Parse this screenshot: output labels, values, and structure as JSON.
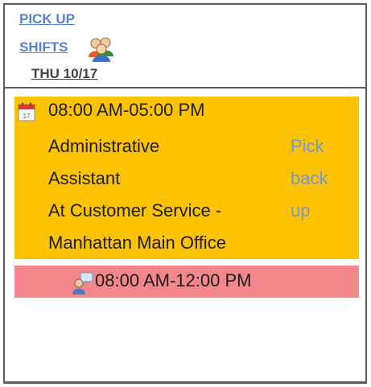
{
  "header": {
    "pickup_line1": "PICK UP",
    "pickup_line2": "SHIFTS",
    "people_icon": "users-icon",
    "date": "THU 10/17"
  },
  "shift": {
    "icon": "calendar-icon",
    "time": "08:00 AM-05:00 PM",
    "role_lines": [
      "Administrative",
      "Assistant",
      "At Customer Service -",
      "Manhattan Main Office"
    ],
    "action_lines": [
      "Pick",
      "back",
      "up"
    ]
  },
  "pickup_slot": {
    "icon": "chat-user-icon",
    "time": "08:00 AM-12:00 PM"
  },
  "colors": {
    "shift_bg": "#fdc300",
    "pickup_bg": "#f3878c",
    "link": "#5a82c8"
  }
}
